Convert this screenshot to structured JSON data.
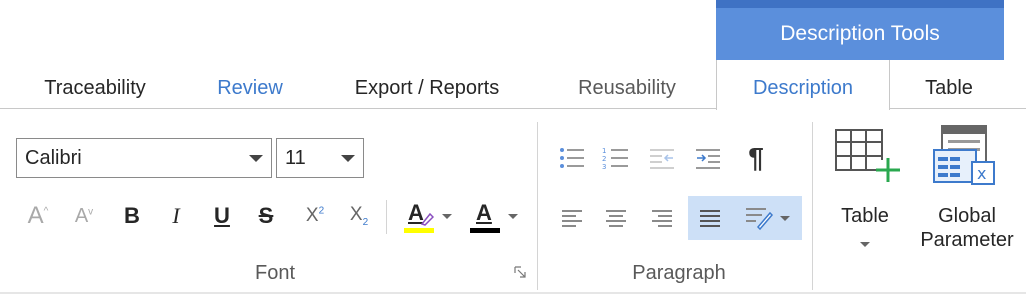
{
  "contextual_group": {
    "label": "Description Tools",
    "color": "#5b8fdc"
  },
  "tabs": [
    {
      "label": "Traceability",
      "state": "normal"
    },
    {
      "label": "Review",
      "state": "link"
    },
    {
      "label": "Export / Reports",
      "state": "normal"
    },
    {
      "label": "Reusability",
      "state": "dim"
    },
    {
      "label": "Description",
      "state": "active"
    },
    {
      "label": "Table",
      "state": "normal"
    }
  ],
  "font_group": {
    "label": "Font",
    "font_name": "Calibri",
    "font_size": "11",
    "buttons": {
      "grow_font": "A",
      "shrink_font": "A",
      "bold": "B",
      "italic": "I",
      "underline": "U",
      "strikethrough": "S",
      "superscript": "X",
      "subscript": "X",
      "highlight": "A",
      "font_color": "A"
    },
    "highlight_color": "#ffff00",
    "font_color_value": "#000000"
  },
  "paragraph_group": {
    "label": "Paragraph",
    "pilcrow": "¶"
  },
  "insert_group": {
    "table_label": "Table",
    "global_parameter_label_1": "Global",
    "global_parameter_label_2": "Parameter"
  }
}
